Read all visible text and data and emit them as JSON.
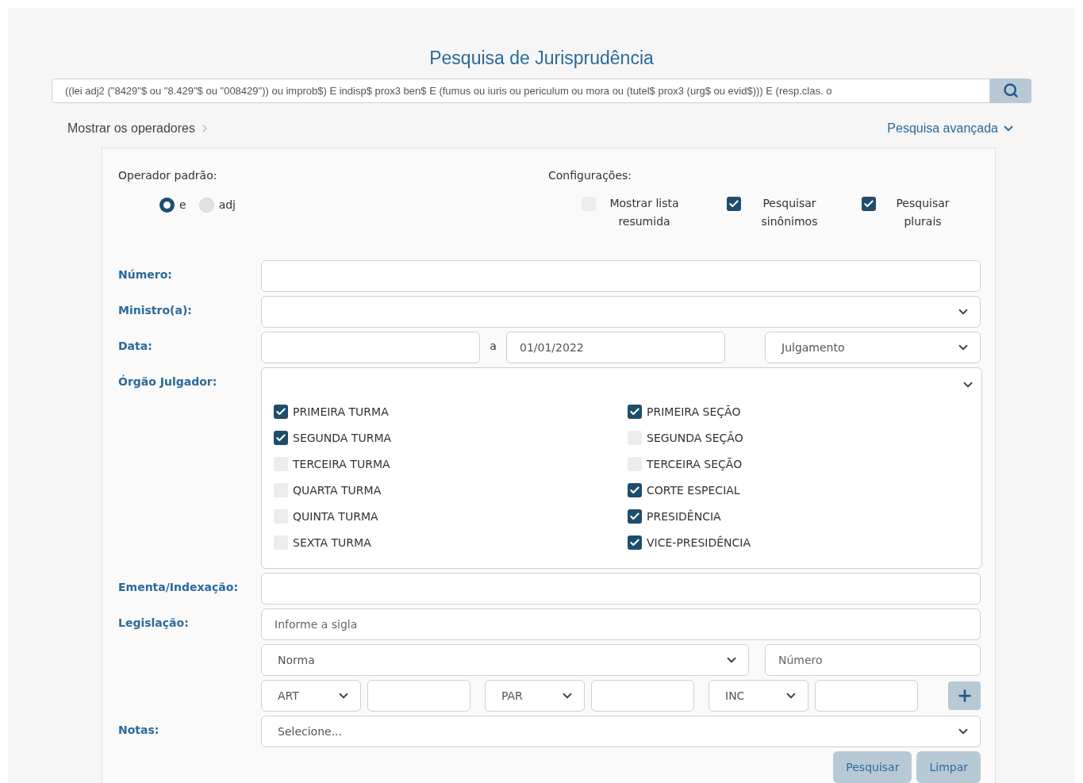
{
  "title": "Pesquisa de Jurisprudência",
  "search": {
    "value": "((lei adj2 (\"8429\"$ ou \"8.429\"$ ou \"008429\")) ou improb$) E indisp$ prox3 ben$ E (fumus ou iuris ou periculum ou mora ou (tutel$ prox3 (urg$ ou evid$))) E (resp.clas. o"
  },
  "links": {
    "operators": "Mostrar os operadores",
    "advanced": "Pesquisa avançada"
  },
  "operator": {
    "label": "Operador padrão:",
    "options": [
      {
        "label": "e",
        "selected": true
      },
      {
        "label": "adj",
        "selected": false
      }
    ]
  },
  "config": {
    "label": "Configurações:",
    "options": [
      {
        "label": "Mostrar lista resumida",
        "checked": false
      },
      {
        "label": "Pesquisar sinônimos",
        "checked": true
      },
      {
        "label": "Pesquisar plurais",
        "checked": true
      }
    ]
  },
  "numero": {
    "label": "Número:"
  },
  "ministro": {
    "label": "Ministro(a):"
  },
  "data": {
    "label": "Data:",
    "separator": "a",
    "to": "01/01/2022",
    "type": "Julgamento"
  },
  "orgao": {
    "label": "Órgão Julgador:",
    "columns": [
      [
        {
          "label": "PRIMEIRA TURMA",
          "checked": true
        },
        {
          "label": "SEGUNDA TURMA",
          "checked": true
        },
        {
          "label": "TERCEIRA TURMA",
          "checked": false
        },
        {
          "label": "QUARTA TURMA",
          "checked": false
        },
        {
          "label": "QUINTA TURMA",
          "checked": false
        },
        {
          "label": "SEXTA TURMA",
          "checked": false
        }
      ],
      [
        {
          "label": "PRIMEIRA SEÇÃO",
          "checked": true
        },
        {
          "label": "SEGUNDA SEÇÃO",
          "checked": false
        },
        {
          "label": "TERCEIRA SEÇÃO",
          "checked": false
        },
        {
          "label": "CORTE ESPECIAL",
          "checked": true
        },
        {
          "label": "PRESIDÊNCIA",
          "checked": true
        },
        {
          "label": "VICE-PRESIDÊNCIA",
          "checked": true
        }
      ]
    ]
  },
  "ementa": {
    "label": "Ementa/Indexação:"
  },
  "legislacao": {
    "label": "Legislação:",
    "placeholder": "Informe a sigla",
    "norma": "Norma",
    "numero_placeholder": "Número",
    "art": "ART",
    "par": "PAR",
    "inc": "INC"
  },
  "notas": {
    "label": "Notas:",
    "value": "Selecione..."
  },
  "buttons": [
    "Pesquisar",
    "Limpar"
  ]
}
